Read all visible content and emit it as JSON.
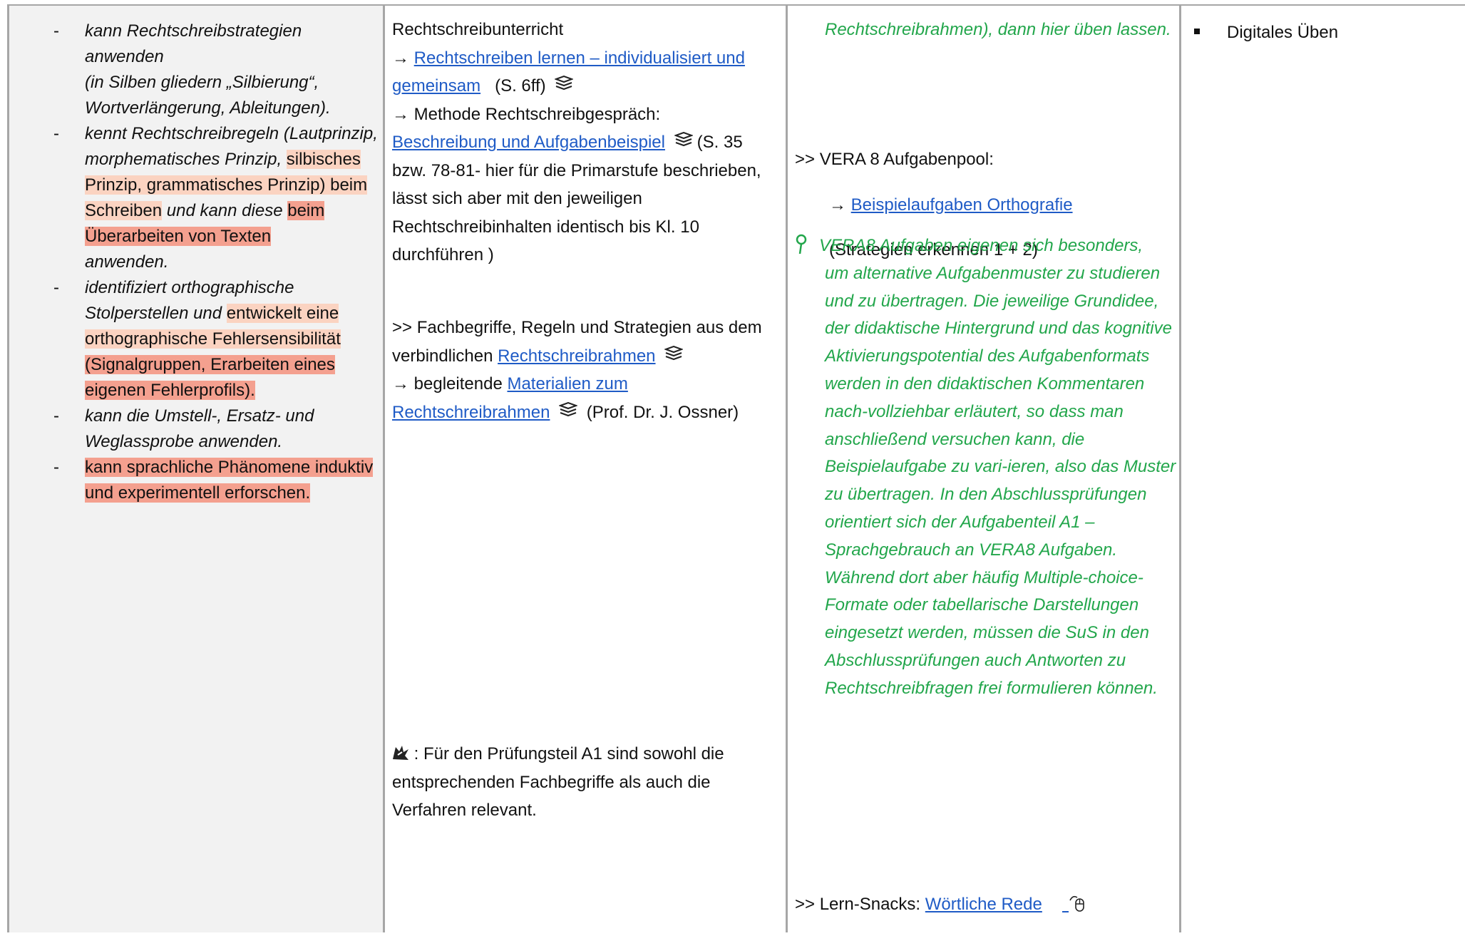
{
  "col1": {
    "items": [
      {
        "segments": [
          {
            "t": "kann Rechtschreibstrategien anwenden",
            "s": "it"
          },
          {
            "t": "(in Silben gliedern „Silbierung“, Wortverlängerung, Ableitungen).",
            "s": "it",
            "br": true
          }
        ]
      },
      {
        "segments": [
          {
            "t": "kennt Rechtschreibregeln (Lautprinzip, morphematisches Prinzip, ",
            "s": "it"
          },
          {
            "t": "silbisches Prinzip, grammatisches Prinzip) beim Schreiben",
            "s": "hl-l"
          },
          {
            "t": " und kann diese ",
            "s": "it"
          },
          {
            "t": "beim Überarbeiten von Texten",
            "s": "hl-d"
          },
          {
            "t": " anwenden.",
            "s": "it"
          }
        ]
      },
      {
        "segments": [
          {
            "t": "identifiziert orthographische Stolperstellen und ",
            "s": "it"
          },
          {
            "t": "entwickelt eine orthographische Fehlersensibilität",
            "s": "hl-l"
          },
          {
            "t": " (Signalgruppen, Erarbeiten eines eigenen Fehlerprofils).",
            "s": "hl-d"
          }
        ]
      },
      {
        "segments": [
          {
            "t": "kann die Umstell-, Ersatz- und Weglassprobe anwenden.",
            "s": "it"
          }
        ]
      },
      {
        "segments": [
          {
            "t": "kann sprachliche Phänomene induktiv und experimentell erforschen.",
            "s": "hl-d"
          }
        ]
      }
    ],
    "dash": "-"
  },
  "col2": {
    "heading": "Rechtschreibunterricht",
    "arrow": "→",
    "link1": "Rechtschreiben lernen – individualisiert und gemeinsam",
    "page1": "(S. 6ff)",
    "method_label": "Methode Rechtschreibgespräch:",
    "link2": "Beschreibung und Aufgabenbeispiel",
    "method_note": "(S. 35 bzw. 78-81- hier für die Primarstufe beschrieben, lässt sich aber mit den jeweiligen Rechtschreibinhalten identisch bis Kl. 10 durchführen )",
    "terms_text": ">> Fachbegriffe, Regeln und Strategien aus dem verbindlichen",
    "link3": "Rechtschreibrahmen",
    "accomp_label": "begleitende",
    "link4": "Materialien zum Rechtschreibrahmen",
    "author": "(Prof. Dr. J. Ossner)",
    "exam_note": ": Für den Prüfungsteil A1 sind sowohl die entsprechenden Fachbegriffe als auch die Verfahren relevant.",
    "book_icon": "book-stack-icon",
    "exam_icon": "exclamation-splash-icon"
  },
  "col3": {
    "top_green": "Rechtschreibrahmen), dann hier üben lassen.",
    "vera_label": ">> VERA 8 Aufgabenpool:",
    "arrow": "→",
    "vera_link": "Beispielaufgaben Orthografie",
    "vera_note": "(Strategien erkennen 1 + 2)",
    "tip_first": "VERA8 Aufgaben eigenen sich besonders,",
    "tip_rest": "um alternative Aufgabenmuster zu studieren und zu übertragen. Die jeweilige Grundidee, der didaktische Hintergrund und das kognitive Aktivierungspotential des Aufgabenformats werden in den didaktischen Kommentaren nach-vollziehbar erläutert, so dass man anschließend versuchen kann, die Beispielaufgabe zu vari-ieren, also das Muster zu übertragen. In den Abschlussprüfungen orientiert sich der Aufgabenteil A1 – Sprachgebrauch an VERA8 Aufgaben. Während dort aber häufig Multiple-choice-Formate oder tabellarische Darstellungen eingesetzt werden, müssen die SuS in den Abschlussprüfungen auch Antworten zu Rechtschreibfragen frei formulieren können.",
    "snack_label": ">> Lern-Snacks:",
    "snack_link": "Wörtliche Rede",
    "tip_icon": "tip-pin-icon",
    "mouse_icon": "mouse-icon"
  },
  "col4": {
    "bullet": "Digitales Üben"
  },
  "colors": {
    "link": "#1f5bc6",
    "green": "#22a64b",
    "hl_light": "#fbd3c1",
    "hl_dark": "#f4a08f",
    "col1_bg": "#f2f2f2",
    "border": "#a6a6a6"
  }
}
